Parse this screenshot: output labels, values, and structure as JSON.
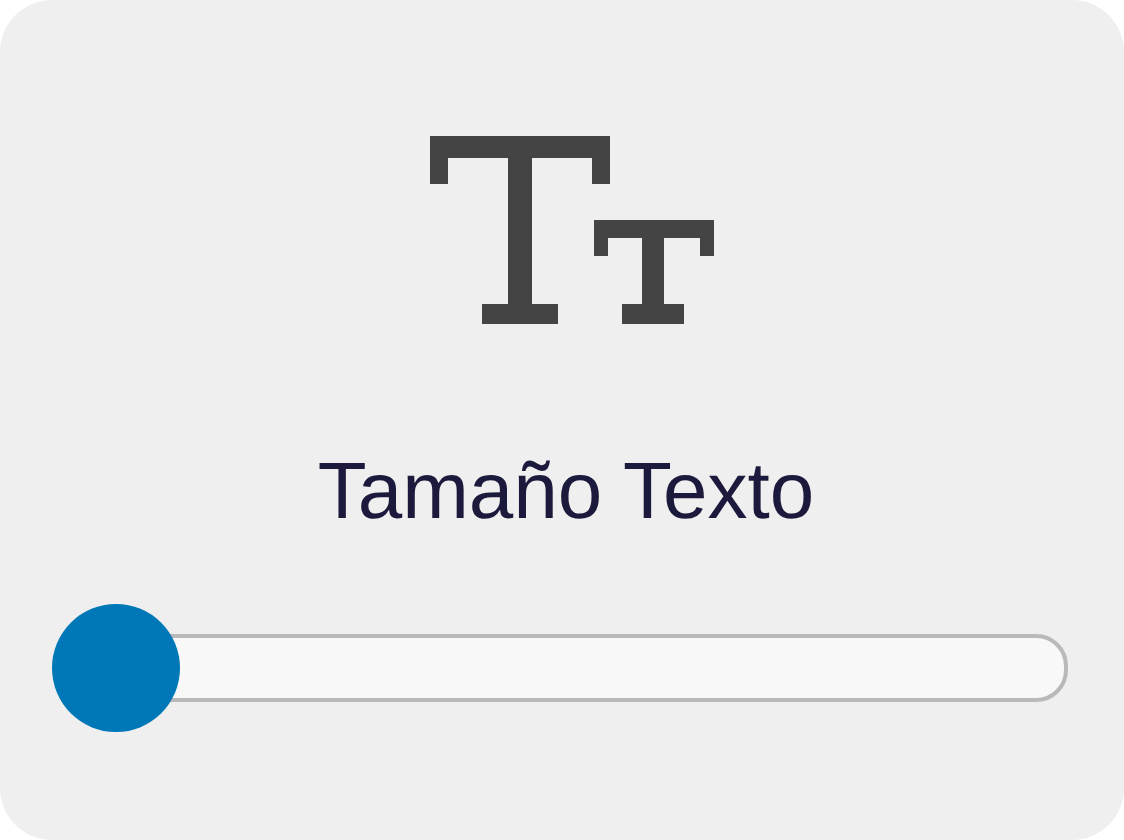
{
  "setting": {
    "label": "Tamaño Texto",
    "slider": {
      "level": 0
    }
  }
}
